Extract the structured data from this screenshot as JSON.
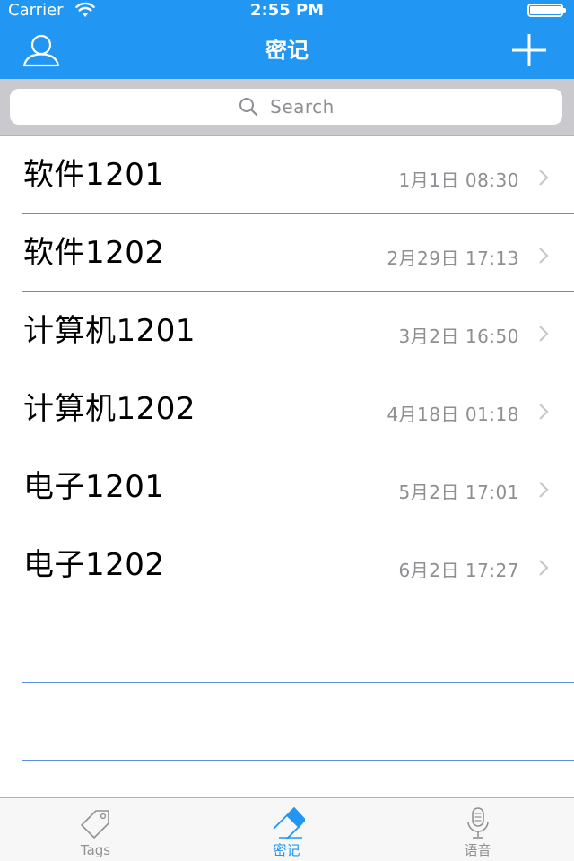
{
  "status_bar": {
    "carrier": "Carrier",
    "time": "2:55 PM",
    "icons": [
      "wifi-icon",
      "battery-icon"
    ]
  },
  "nav": {
    "title": "密记",
    "left_icon": "user-icon",
    "right_icon": "plus-icon"
  },
  "search": {
    "placeholder": "Search",
    "icon": "search-icon"
  },
  "list": {
    "items": [
      {
        "title": "软件1201",
        "date": "1月1日 08:30"
      },
      {
        "title": "软件1202",
        "date": "2月29日 17:13"
      },
      {
        "title": "计算机1201",
        "date": "3月2日 16:50"
      },
      {
        "title": "计算机1202",
        "date": "4月18日 01:18"
      },
      {
        "title": "电子1201",
        "date": "5月2日 17:01"
      },
      {
        "title": "电子1202",
        "date": "6月2日 17:27"
      }
    ]
  },
  "tabbar": {
    "tabs": [
      {
        "label": "Tags",
        "icon": "tag-icon",
        "active": false
      },
      {
        "label": "密记",
        "icon": "eraser-icon",
        "active": true
      },
      {
        "label": "语音",
        "icon": "microphone-icon",
        "active": false
      }
    ]
  },
  "colors": {
    "accent": "#2196f3",
    "separator": "#5b8fe0",
    "secondary_text": "#8e8e93",
    "tab_inactive": "#929292"
  }
}
